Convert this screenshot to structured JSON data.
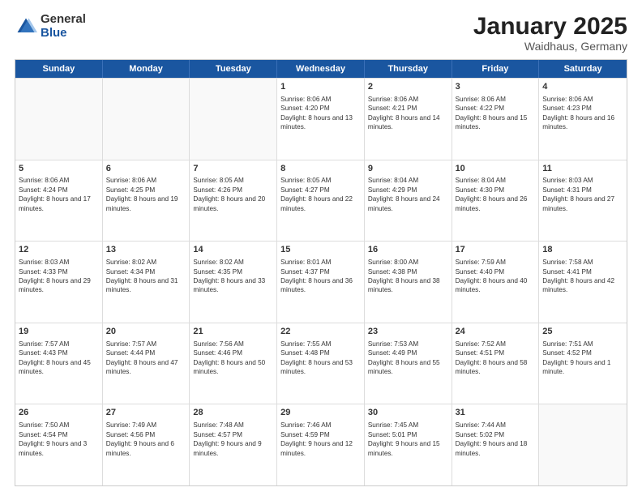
{
  "header": {
    "logo": {
      "general": "General",
      "blue": "Blue"
    },
    "title": "January 2025",
    "location": "Waidhaus, Germany"
  },
  "weekdays": [
    "Sunday",
    "Monday",
    "Tuesday",
    "Wednesday",
    "Thursday",
    "Friday",
    "Saturday"
  ],
  "rows": [
    [
      {
        "day": "",
        "sunrise": "",
        "sunset": "",
        "daylight": ""
      },
      {
        "day": "",
        "sunrise": "",
        "sunset": "",
        "daylight": ""
      },
      {
        "day": "",
        "sunrise": "",
        "sunset": "",
        "daylight": ""
      },
      {
        "day": "1",
        "sunrise": "Sunrise: 8:06 AM",
        "sunset": "Sunset: 4:20 PM",
        "daylight": "Daylight: 8 hours and 13 minutes."
      },
      {
        "day": "2",
        "sunrise": "Sunrise: 8:06 AM",
        "sunset": "Sunset: 4:21 PM",
        "daylight": "Daylight: 8 hours and 14 minutes."
      },
      {
        "day": "3",
        "sunrise": "Sunrise: 8:06 AM",
        "sunset": "Sunset: 4:22 PM",
        "daylight": "Daylight: 8 hours and 15 minutes."
      },
      {
        "day": "4",
        "sunrise": "Sunrise: 8:06 AM",
        "sunset": "Sunset: 4:23 PM",
        "daylight": "Daylight: 8 hours and 16 minutes."
      }
    ],
    [
      {
        "day": "5",
        "sunrise": "Sunrise: 8:06 AM",
        "sunset": "Sunset: 4:24 PM",
        "daylight": "Daylight: 8 hours and 17 minutes."
      },
      {
        "day": "6",
        "sunrise": "Sunrise: 8:06 AM",
        "sunset": "Sunset: 4:25 PM",
        "daylight": "Daylight: 8 hours and 19 minutes."
      },
      {
        "day": "7",
        "sunrise": "Sunrise: 8:05 AM",
        "sunset": "Sunset: 4:26 PM",
        "daylight": "Daylight: 8 hours and 20 minutes."
      },
      {
        "day": "8",
        "sunrise": "Sunrise: 8:05 AM",
        "sunset": "Sunset: 4:27 PM",
        "daylight": "Daylight: 8 hours and 22 minutes."
      },
      {
        "day": "9",
        "sunrise": "Sunrise: 8:04 AM",
        "sunset": "Sunset: 4:29 PM",
        "daylight": "Daylight: 8 hours and 24 minutes."
      },
      {
        "day": "10",
        "sunrise": "Sunrise: 8:04 AM",
        "sunset": "Sunset: 4:30 PM",
        "daylight": "Daylight: 8 hours and 26 minutes."
      },
      {
        "day": "11",
        "sunrise": "Sunrise: 8:03 AM",
        "sunset": "Sunset: 4:31 PM",
        "daylight": "Daylight: 8 hours and 27 minutes."
      }
    ],
    [
      {
        "day": "12",
        "sunrise": "Sunrise: 8:03 AM",
        "sunset": "Sunset: 4:33 PM",
        "daylight": "Daylight: 8 hours and 29 minutes."
      },
      {
        "day": "13",
        "sunrise": "Sunrise: 8:02 AM",
        "sunset": "Sunset: 4:34 PM",
        "daylight": "Daylight: 8 hours and 31 minutes."
      },
      {
        "day": "14",
        "sunrise": "Sunrise: 8:02 AM",
        "sunset": "Sunset: 4:35 PM",
        "daylight": "Daylight: 8 hours and 33 minutes."
      },
      {
        "day": "15",
        "sunrise": "Sunrise: 8:01 AM",
        "sunset": "Sunset: 4:37 PM",
        "daylight": "Daylight: 8 hours and 36 minutes."
      },
      {
        "day": "16",
        "sunrise": "Sunrise: 8:00 AM",
        "sunset": "Sunset: 4:38 PM",
        "daylight": "Daylight: 8 hours and 38 minutes."
      },
      {
        "day": "17",
        "sunrise": "Sunrise: 7:59 AM",
        "sunset": "Sunset: 4:40 PM",
        "daylight": "Daylight: 8 hours and 40 minutes."
      },
      {
        "day": "18",
        "sunrise": "Sunrise: 7:58 AM",
        "sunset": "Sunset: 4:41 PM",
        "daylight": "Daylight: 8 hours and 42 minutes."
      }
    ],
    [
      {
        "day": "19",
        "sunrise": "Sunrise: 7:57 AM",
        "sunset": "Sunset: 4:43 PM",
        "daylight": "Daylight: 8 hours and 45 minutes."
      },
      {
        "day": "20",
        "sunrise": "Sunrise: 7:57 AM",
        "sunset": "Sunset: 4:44 PM",
        "daylight": "Daylight: 8 hours and 47 minutes."
      },
      {
        "day": "21",
        "sunrise": "Sunrise: 7:56 AM",
        "sunset": "Sunset: 4:46 PM",
        "daylight": "Daylight: 8 hours and 50 minutes."
      },
      {
        "day": "22",
        "sunrise": "Sunrise: 7:55 AM",
        "sunset": "Sunset: 4:48 PM",
        "daylight": "Daylight: 8 hours and 53 minutes."
      },
      {
        "day": "23",
        "sunrise": "Sunrise: 7:53 AM",
        "sunset": "Sunset: 4:49 PM",
        "daylight": "Daylight: 8 hours and 55 minutes."
      },
      {
        "day": "24",
        "sunrise": "Sunrise: 7:52 AM",
        "sunset": "Sunset: 4:51 PM",
        "daylight": "Daylight: 8 hours and 58 minutes."
      },
      {
        "day": "25",
        "sunrise": "Sunrise: 7:51 AM",
        "sunset": "Sunset: 4:52 PM",
        "daylight": "Daylight: 9 hours and 1 minute."
      }
    ],
    [
      {
        "day": "26",
        "sunrise": "Sunrise: 7:50 AM",
        "sunset": "Sunset: 4:54 PM",
        "daylight": "Daylight: 9 hours and 3 minutes."
      },
      {
        "day": "27",
        "sunrise": "Sunrise: 7:49 AM",
        "sunset": "Sunset: 4:56 PM",
        "daylight": "Daylight: 9 hours and 6 minutes."
      },
      {
        "day": "28",
        "sunrise": "Sunrise: 7:48 AM",
        "sunset": "Sunset: 4:57 PM",
        "daylight": "Daylight: 9 hours and 9 minutes."
      },
      {
        "day": "29",
        "sunrise": "Sunrise: 7:46 AM",
        "sunset": "Sunset: 4:59 PM",
        "daylight": "Daylight: 9 hours and 12 minutes."
      },
      {
        "day": "30",
        "sunrise": "Sunrise: 7:45 AM",
        "sunset": "Sunset: 5:01 PM",
        "daylight": "Daylight: 9 hours and 15 minutes."
      },
      {
        "day": "31",
        "sunrise": "Sunrise: 7:44 AM",
        "sunset": "Sunset: 5:02 PM",
        "daylight": "Daylight: 9 hours and 18 minutes."
      },
      {
        "day": "",
        "sunrise": "",
        "sunset": "",
        "daylight": ""
      }
    ]
  ]
}
